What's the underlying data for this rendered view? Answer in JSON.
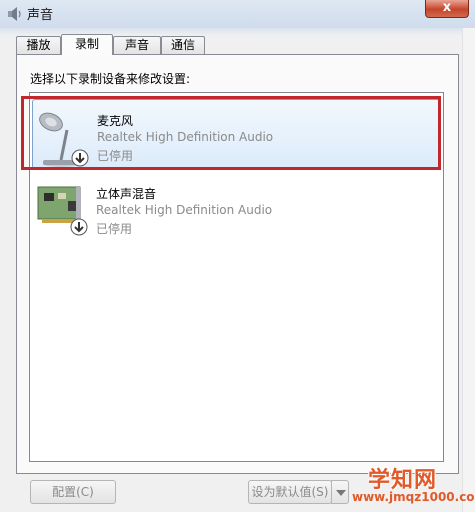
{
  "window": {
    "title": "声音",
    "close_label": "x"
  },
  "tabs": [
    {
      "label": "播放"
    },
    {
      "label": "录制",
      "active": true
    },
    {
      "label": "声音"
    },
    {
      "label": "通信"
    }
  ],
  "panel": {
    "instruction": "选择以下录制设备来修改设置:",
    "devices": [
      {
        "name": "麦克风",
        "driver": "Realtek High Definition Audio",
        "status": "已停用",
        "icon": "microphone-icon",
        "selected": true
      },
      {
        "name": "立体声混音",
        "driver": "Realtek High Definition Audio",
        "status": "已停用",
        "icon": "sound-card-icon",
        "selected": false
      }
    ]
  },
  "buttons": {
    "configure": "配置(C)",
    "set_default": "设为默认值(S)"
  },
  "watermark": {
    "logo": "学知网",
    "url": "www.jmqz1000.com"
  },
  "colors": {
    "highlight_border": "#c0282e",
    "selection_border": "#7da2ce",
    "watermark": "#e05a2a"
  }
}
